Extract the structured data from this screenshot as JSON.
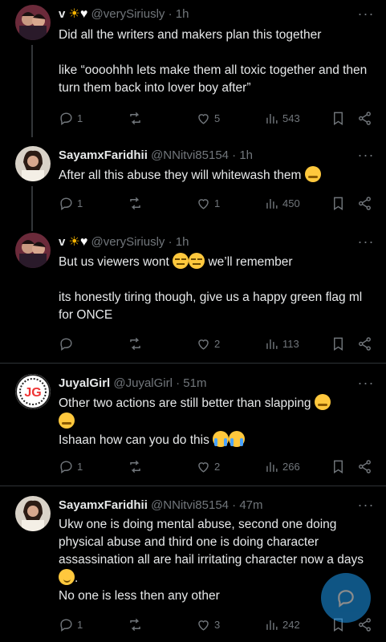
{
  "tweets": [
    {
      "name": "v",
      "name_emoji": [
        "sun",
        "white-heart"
      ],
      "handle": "@verySiriusly",
      "time": "1h",
      "lines": [
        "Did all the writers and makers plan this together",
        "",
        "like “oooohhh lets make them all toxic together and then turn them back into lover boy after”"
      ],
      "reply_count": "1",
      "retweet_count": "",
      "like_count": "5",
      "view_count": "543"
    },
    {
      "name": "SayamxFaridhii",
      "handle": "@NNitvi85154",
      "time": "1h",
      "text_a": "After all this abuse they will whitewash them",
      "reply_count": "1",
      "retweet_count": "",
      "like_count": "1",
      "view_count": "450"
    },
    {
      "name": "v",
      "handle": "@verySiriusly",
      "time": "1h",
      "text_a": "But us viewers wont",
      "text_b": "we’ll  remember",
      "text_c": "its honestly tiring though, give us a happy green flag ml for ONCE",
      "reply_count": "",
      "retweet_count": "",
      "like_count": "2",
      "view_count": "113"
    },
    {
      "name": "JuyalGirl",
      "handle": "@JuyalGirl",
      "time": "51m",
      "text_a": "Other two actions are still better than slapping",
      "text_b": "Ishaan how can you do this",
      "reply_count": "1",
      "retweet_count": "",
      "like_count": "2",
      "view_count": "266"
    },
    {
      "name": "SayamxFaridhii",
      "handle": "@NNitvi85154",
      "time": "47m",
      "text_a": "Ukw one is doing mental abuse, second one doing physical abuse and third one is doing character assassination all are hail irritating character now a days",
      "text_b": "No one is less then any other",
      "reply_count": "1",
      "retweet_count": "",
      "like_count": "3",
      "view_count": "242"
    }
  ],
  "colors": {
    "background": "#000000",
    "text": "#e7e9ea",
    "muted": "#71767b",
    "accent": "#1d9bf0"
  }
}
